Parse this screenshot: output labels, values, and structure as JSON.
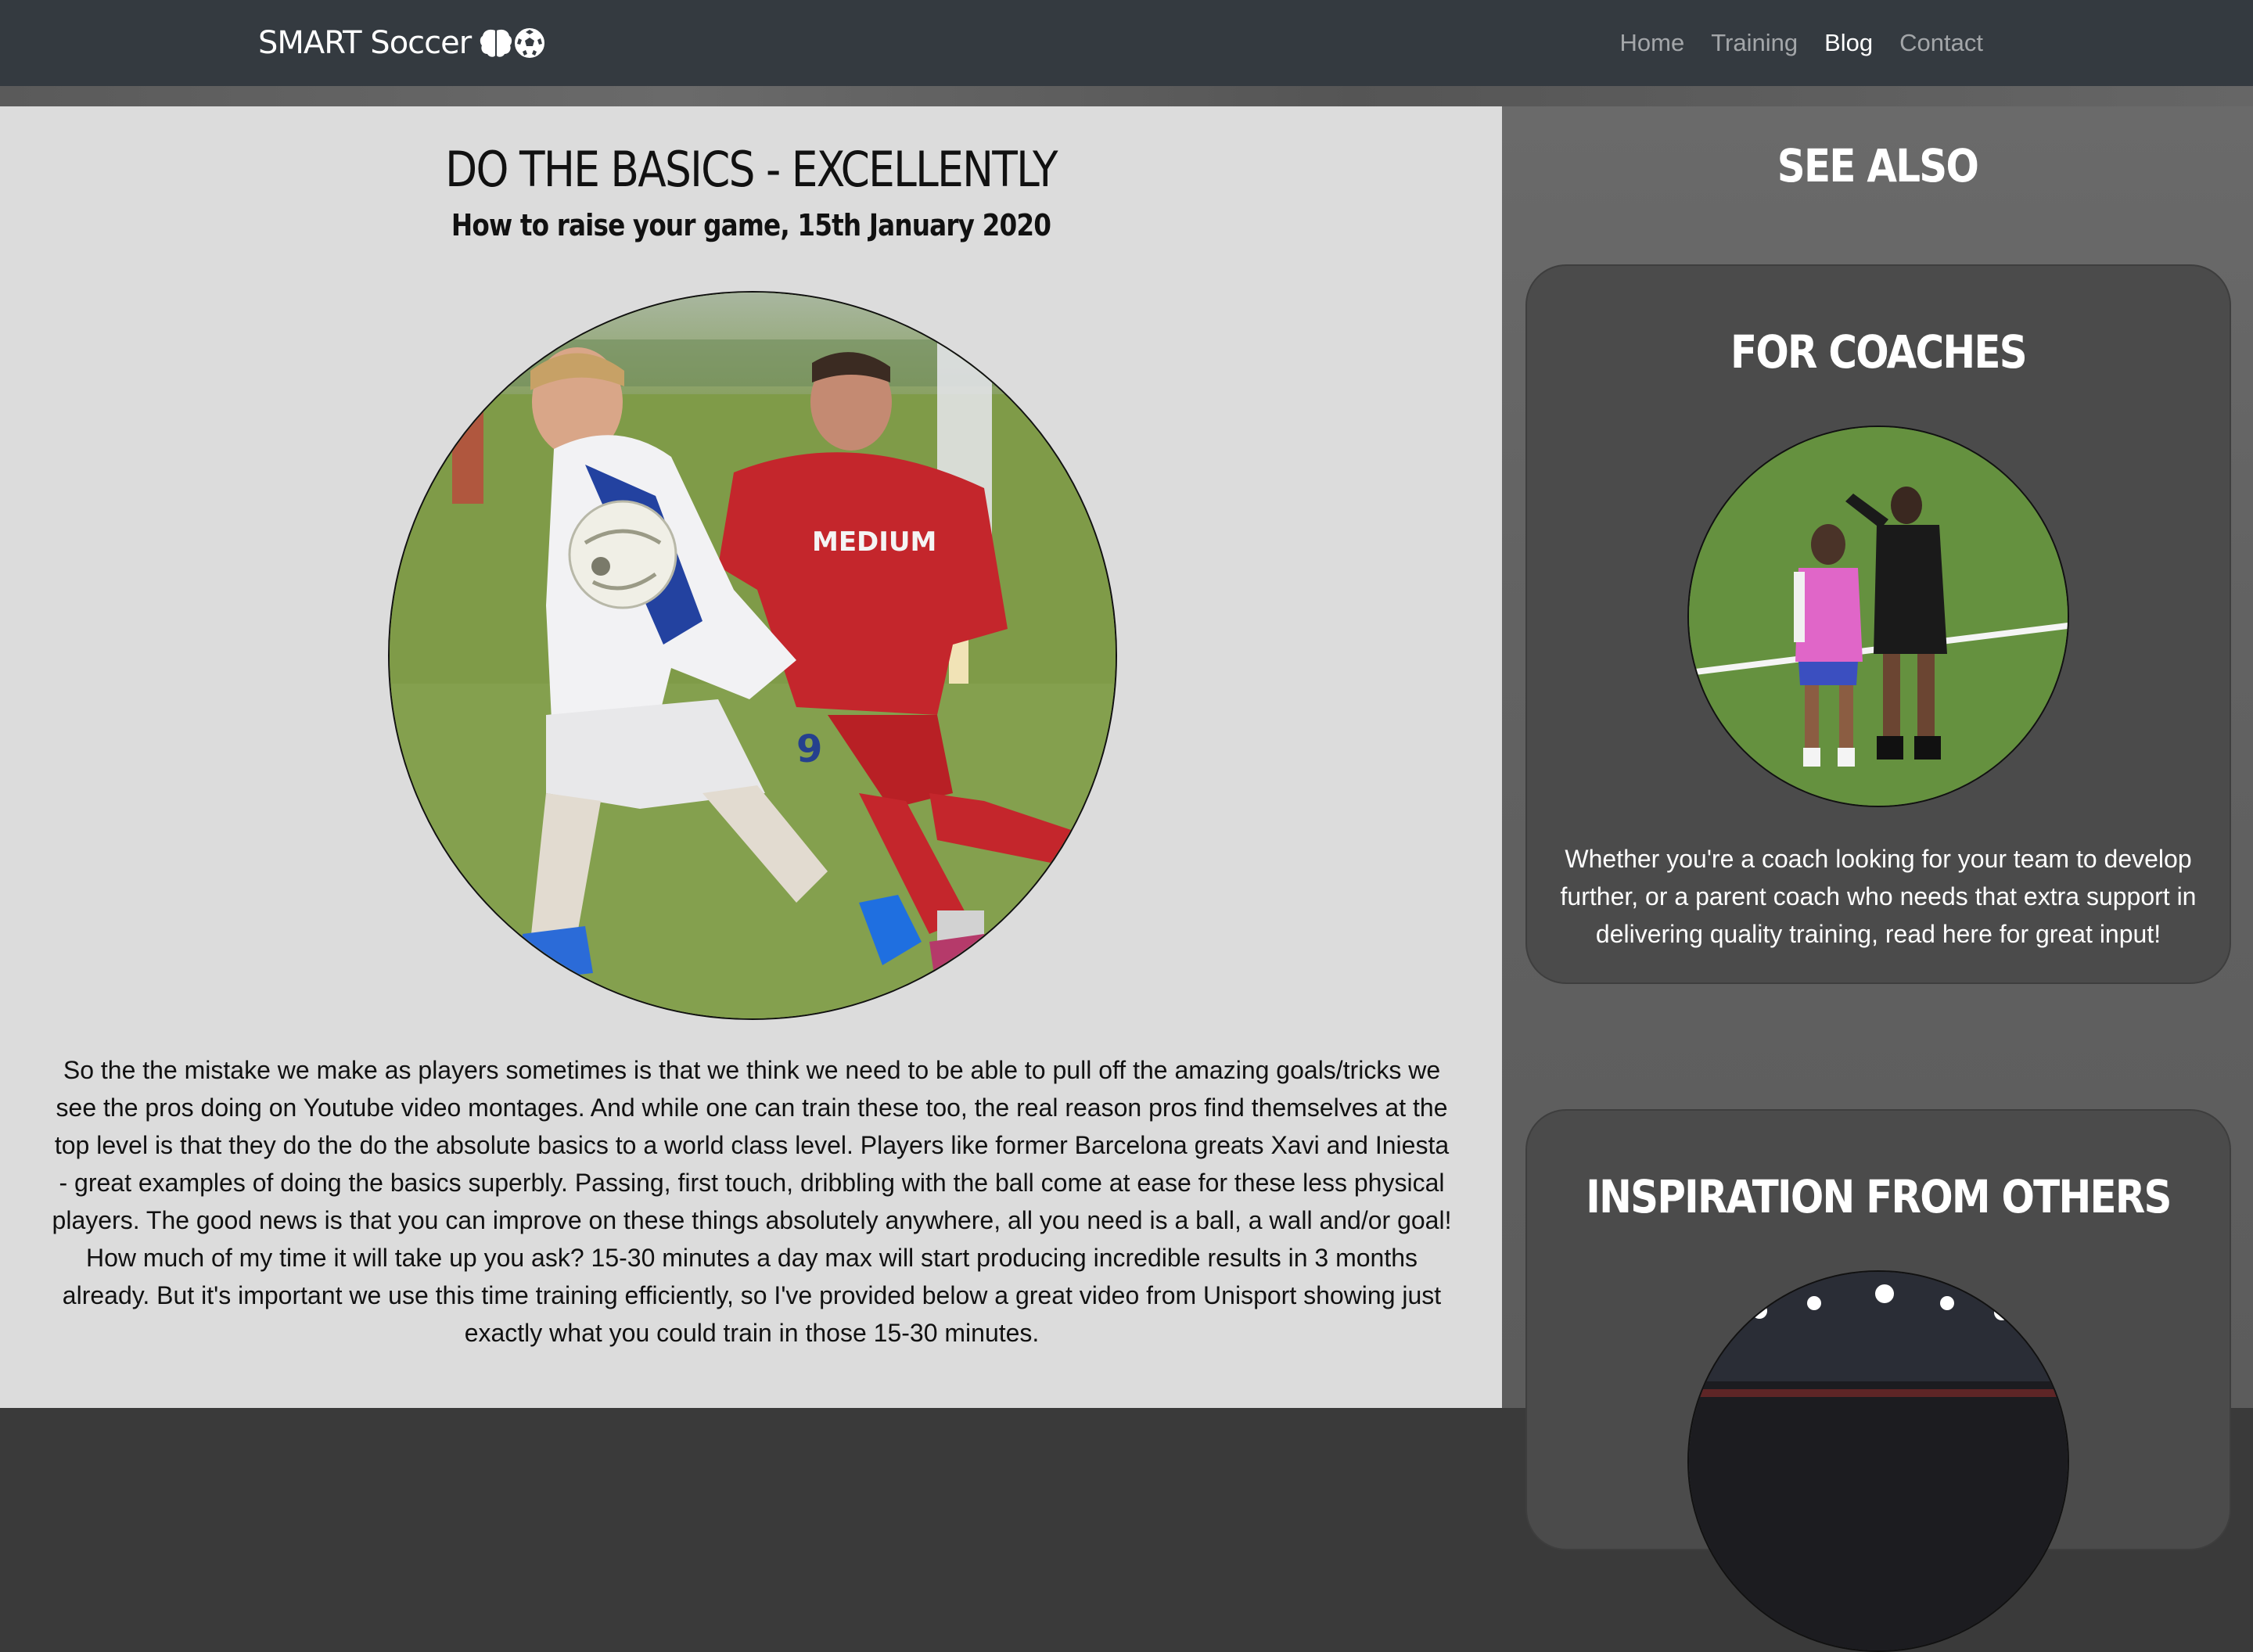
{
  "navbar": {
    "brand": "SMART Soccer",
    "links": [
      {
        "label": "Home",
        "active": false
      },
      {
        "label": "Training",
        "active": false
      },
      {
        "label": "Blog",
        "active": true
      },
      {
        "label": "Contact",
        "active": false
      }
    ],
    "brand_icons": [
      "brain-icon",
      "soccer-ball-icon"
    ]
  },
  "article": {
    "title": "DO THE BASICS - EXCELLENTLY",
    "subtitle": "How to raise your game, 15th January 2020",
    "hero_jersey_text": "MEDIUM",
    "hero_number": "9",
    "body": "So the the mistake we make as players sometimes is that we think we need to be able to pull off the amazing goals/tricks we see the pros doing on Youtube video montages. And while one can train these too, the real reason pros find themselves at the top level is that they do the do the absolute basics to a world class level. Players like former Barcelona greats Xavi and Iniesta - great examples of doing the basics superbly. Passing, first touch, dribbling with the ball come at ease for these less physical players. The good news is that you can improve on these things absolutely anywhere, all you need is a ball, a wall and/or goal! How much of my time it will take up you ask? 15-30 minutes a day max will start producing incredible results in 3 months already. But it's important we use this time training efficiently, so I've provided below a great video from Unisport showing just exactly what you could train in those 15-30 minutes."
  },
  "sidebar": {
    "heading": "SEE ALSO",
    "cards": [
      {
        "title": "FOR COACHES",
        "text": "Whether you're a coach looking for your team to develop further, or a parent coach who needs that extra support in delivering quality training, read here for great input!"
      },
      {
        "title": "INSPIRATION FROM OTHERS",
        "text": ""
      }
    ]
  },
  "colors": {
    "navbar": "#343a40",
    "article_bg": "#dcdcdc",
    "card_bg": "#4b4b4b",
    "sidebar_bg": "#646464"
  }
}
